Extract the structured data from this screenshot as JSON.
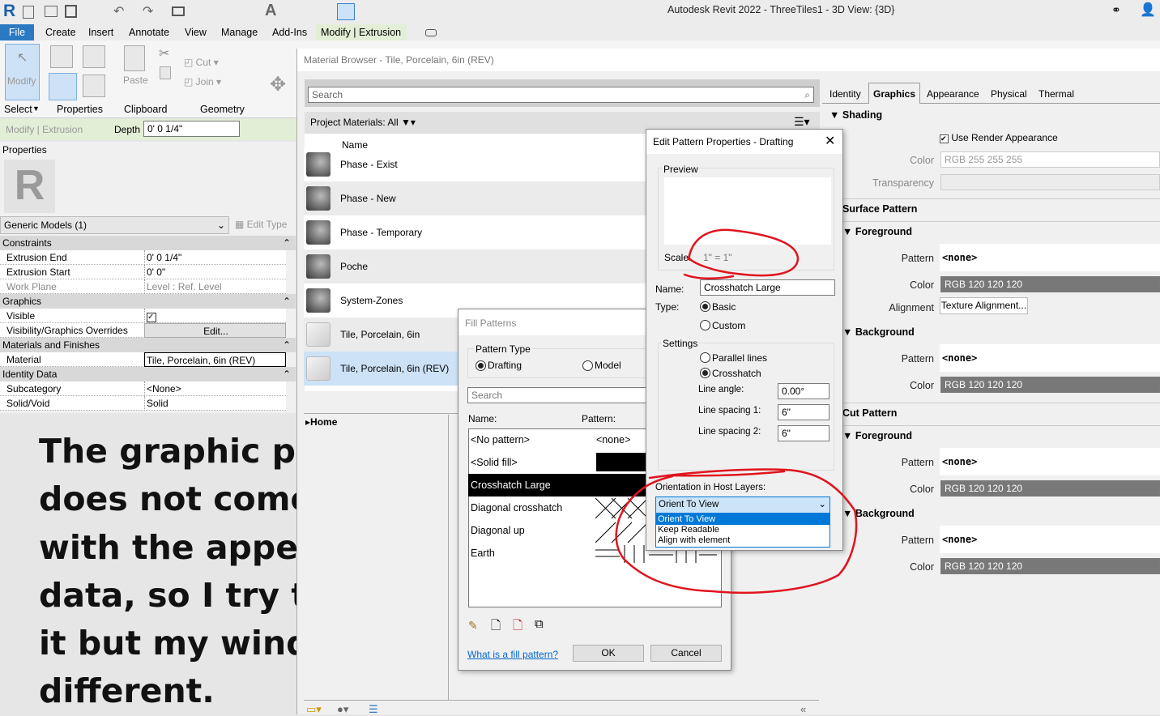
{
  "app": {
    "title": "Autodesk Revit 2022 - ThreeTiles1 - 3D View: {3D}",
    "logo": "R"
  },
  "ribbon": {
    "tabs": [
      "File",
      "Create",
      "Insert",
      "Annotate",
      "View",
      "Manage",
      "Add-Ins",
      "Modify | Extrusion"
    ],
    "active_tab": "Modify | Extrusion",
    "modify_label": "Modify",
    "panels": [
      "Select",
      "Properties",
      "Clipboard",
      "Geometry"
    ],
    "paste_label": "Paste",
    "cut_label": "Cut",
    "join_label": "Join"
  },
  "options_bar": {
    "context": "Modify | Extrusion",
    "depth_label": "Depth",
    "depth_value": "0'  0 1/4\""
  },
  "properties": {
    "title": "Properties",
    "type_selector": "Generic Models (1)",
    "edit_type": "Edit Type",
    "sections": [
      {
        "name": "Constraints",
        "rows": [
          {
            "label": "Extrusion End",
            "value": "0'  0 1/4\""
          },
          {
            "label": "Extrusion Start",
            "value": "0'  0\""
          },
          {
            "label": "Work Plane",
            "value": "Level : Ref. Level"
          }
        ]
      },
      {
        "name": "Graphics",
        "rows": [
          {
            "label": "Visible",
            "value": "checked"
          },
          {
            "label": "Visibility/Graphics Overrides",
            "value": "Edit..."
          }
        ]
      },
      {
        "name": "Materials and Finishes",
        "rows": [
          {
            "label": "Material",
            "value": "Tile, Porcelain, 6in (REV)"
          }
        ]
      },
      {
        "name": "Identity Data",
        "rows": [
          {
            "label": "Subcategory",
            "value": "<None>"
          },
          {
            "label": "Solid/Void",
            "value": "Solid"
          }
        ]
      }
    ]
  },
  "note": {
    "lines": [
      "The graphic pattern",
      "does not come in",
      "with the appearance",
      "data, so I try to re-create",
      "it but my window is",
      "different."
    ]
  },
  "material_browser": {
    "title": "Material Browser - Tile, Porcelain, 6in (REV)",
    "search_placeholder": "Search",
    "filter_label": "Project Materials: All",
    "name_header": "Name",
    "materials": [
      "Phase - Exist",
      "Phase - New",
      "Phase - Temporary",
      "Poche",
      "System-Zones",
      "Tile, Porcelain, 6in",
      "Tile, Porcelain, 6in (REV)"
    ],
    "selected": "Tile, Porcelain, 6in (REV)",
    "library_home": "Home",
    "tabs": [
      "Identity",
      "Graphics",
      "Appearance",
      "Physical",
      "Thermal"
    ],
    "active_tab": "Graphics",
    "graphics": {
      "shading": "Shading",
      "use_render": "Use Render Appearance",
      "color_label": "Color",
      "shading_color": "RGB 255 255 255",
      "transparency_label": "Transparency",
      "surface_pattern": "Surface Pattern",
      "cut_pattern": "Cut Pattern",
      "foreground": "Foreground",
      "background": "Background",
      "pattern_label": "Pattern",
      "alignment_label": "Alignment",
      "pattern_value": "<none>",
      "pattern_color": "RGB 120 120 120",
      "texture_alignment": "Texture Alignment..."
    }
  },
  "fill_patterns": {
    "title": "Fill Patterns",
    "pattern_type": "Pattern Type",
    "drafting": "Drafting",
    "model": "Model",
    "selected_type": "Drafting",
    "search_placeholder": "Search",
    "name_header": "Name:",
    "pattern_header": "Pattern:",
    "rows": [
      {
        "name": "<No pattern>",
        "pattern": "<none>"
      },
      {
        "name": "<Solid fill>"
      },
      {
        "name": "Crosshatch Large"
      },
      {
        "name": "Diagonal crosshatch"
      },
      {
        "name": "Diagonal up"
      },
      {
        "name": "Earth"
      }
    ],
    "selected": "Crosshatch Large",
    "help_link": "What is a fill pattern?",
    "ok": "OK",
    "cancel": "Cancel"
  },
  "edit_pattern": {
    "title": "Edit Pattern Properties - Drafting",
    "preview": "Preview",
    "scale_label": "Scale:",
    "scale_value": "1\" = 1\"",
    "name_label": "Name:",
    "name_value": "Crosshatch Large",
    "type_label": "Type:",
    "basic": "Basic",
    "custom": "Custom",
    "settings": "Settings",
    "parallel": "Parallel lines",
    "crosshatch": "Crosshatch",
    "angle_label": "Line angle:",
    "angle_value": "0.00°",
    "spacing1_label": "Line spacing 1:",
    "spacing1_value": "6\"",
    "spacing2_label": "Line spacing 2:",
    "spacing2_value": "6\"",
    "orientation_label": "Orientation in Host Layers:",
    "orientation_value": "Orient To View",
    "orientation_options": [
      "Orient To View",
      "Keep Readable",
      "Align with element"
    ]
  },
  "colors": {
    "file_tab": "#2b79c2",
    "context_tab": "#e2eed6",
    "selection": "#0078d7",
    "annotation": "#e0141e",
    "list_selected": "#cde2f7"
  }
}
